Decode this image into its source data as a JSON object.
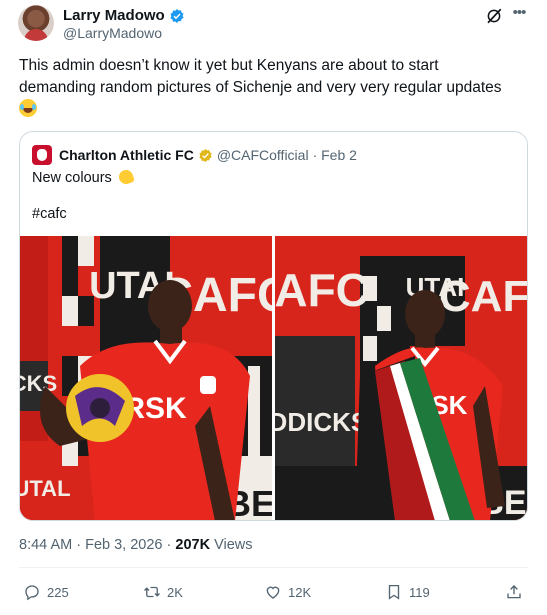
{
  "author": {
    "display_name": "Larry Madowo",
    "handle": "@LarryMadowo",
    "verified": true
  },
  "tweet": {
    "text": "This admin doesn’t know it yet but Kenyans are about to start demanding random pictures of Sichenje and very very regular updates",
    "emoji": "laughing-crying-emoji"
  },
  "quoted": {
    "display_name": "Charlton Athletic FC",
    "handle": "@CAFCofficial",
    "date": "· Feb 2",
    "text_line1": "New colours",
    "text_line2": "#cafc",
    "images": [
      {
        "caption_words": [
          "UTAI",
          "CAFC",
          "CKS",
          "BE",
          "UTAL",
          "RSK"
        ]
      },
      {
        "caption_words": [
          "CAFC",
          "ADDICKS",
          "UTAI",
          "CAFC",
          "BE",
          "RSK"
        ]
      }
    ]
  },
  "meta": {
    "time_date": "8:44 AM · Feb 3, 2026 · ",
    "views_count": "207K",
    "views_label": " Views"
  },
  "actions": {
    "replies": "225",
    "reposts": "2K",
    "likes": "12K",
    "bookmarks": "119"
  },
  "colors": {
    "verified_blue": "#1d9bf0",
    "verified_gold": "#e2b719",
    "secondary_text": "#536471",
    "kit_red": "#e8281e",
    "brand_red": "#c8102e"
  }
}
